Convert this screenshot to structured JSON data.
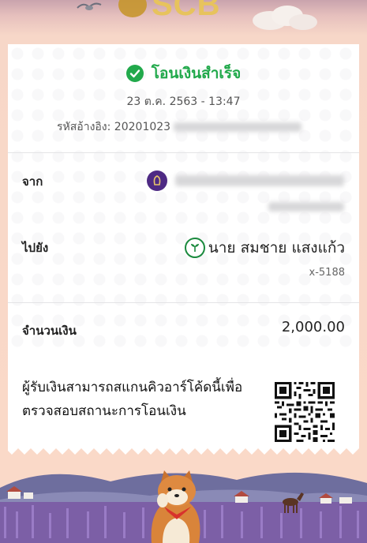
{
  "header": {
    "logo_text": "SCB",
    "logo_mark_color": "#c7962d"
  },
  "receipt": {
    "status_text": "โอนเงินสำเร็จ",
    "status_icon": "check-circle-icon",
    "status_color": "#21a94b",
    "datetime": "23 ต.ค. 2563 - 13:47",
    "reference_label": "รหัสอ้างอิง: 20201023",
    "from_label": "จาก",
    "from_bank_icon": "scb-bank-icon",
    "to_label": "ไปยัง",
    "to_bank_icon": "kbank-bank-icon",
    "to_name": "นาย สมชาย แสงแก้ว",
    "to_account": "x-5188",
    "amount_label": "จำนวนเงิน",
    "amount_value": "2,000.00",
    "qr_text": "ผู้รับเงินสามารถสแกนคิวอาร์โค้ดนี้เพื่อตรวจสอบสถานะการโอนเงิน",
    "qr_icon": "qr-code-icon"
  },
  "scene": {
    "description_icons": [
      "shiba-dog-illustration",
      "horse-illustration",
      "lavender-field-illustration"
    ]
  }
}
